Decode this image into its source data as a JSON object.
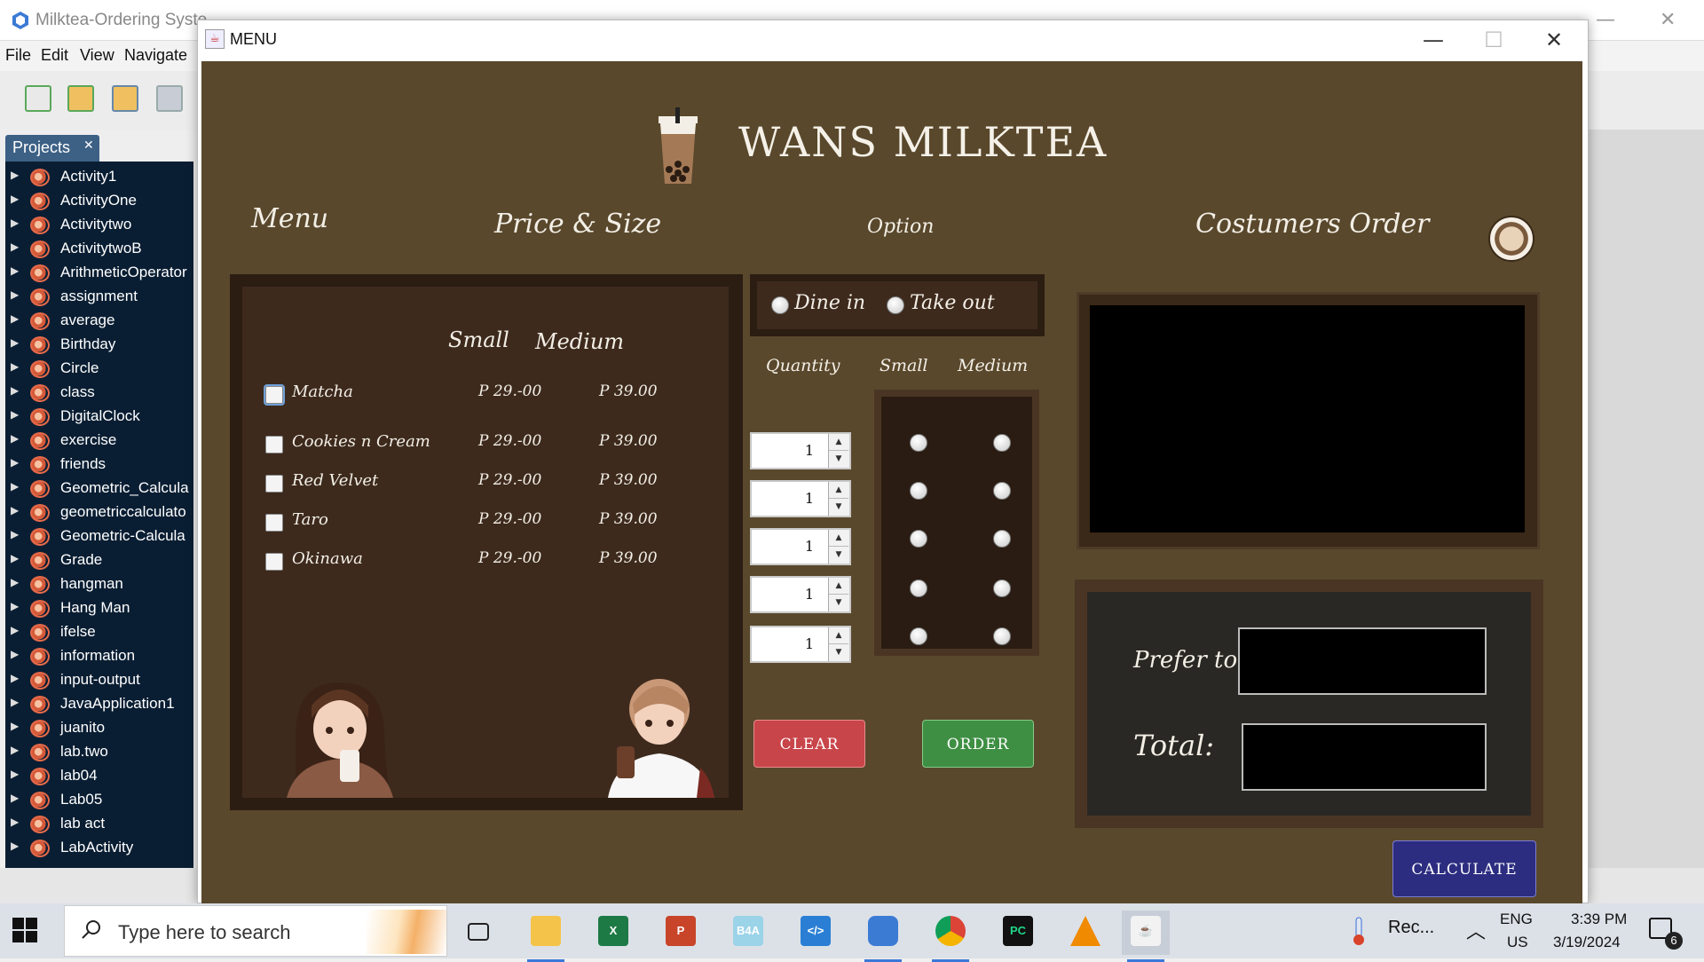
{
  "ide": {
    "title": "Milktea-Ordering Syste",
    "menus": [
      "File",
      "Edit",
      "View",
      "Navigate"
    ],
    "projects_tab": "Projects",
    "projects": [
      "Activity1",
      "ActivityOne",
      "Activitytwo",
      "ActivitytwoB",
      "ArithmeticOperator",
      "assignment",
      "average",
      "Birthday",
      "Circle",
      "class",
      "DigitalClock",
      "exercise",
      "friends",
      "Geometric_Calcula",
      "geometriccalculato",
      "Geometric-Calcula",
      "Grade",
      "hangman",
      "Hang Man",
      "ifelse",
      "information",
      "input-output",
      "JavaApplication1",
      "juanito",
      "lab.two",
      "lab04",
      "Lab05",
      "lab act",
      "LabActivity"
    ]
  },
  "window": {
    "title": "MENU",
    "minimize": "—",
    "maximize": "☐",
    "close": "✕"
  },
  "app": {
    "shop_name": "WANS MILKTEA",
    "headers": {
      "menu": "Menu",
      "price_size": "Price & Size",
      "option": "Option",
      "orders": "Costumers Order"
    },
    "price_cols": {
      "small": "Small",
      "medium": "Medium"
    },
    "items": [
      {
        "name": "Matcha",
        "small": "P 29.-00",
        "medium": "P 39.00",
        "checked": false
      },
      {
        "name": "Cookies n Cream",
        "small": "P 29.-00",
        "medium": "P 39.00",
        "checked": false
      },
      {
        "name": "Red Velvet",
        "small": "P 29.-00",
        "medium": "P 39.00",
        "checked": false
      },
      {
        "name": "Taro",
        "small": "P 29.-00",
        "medium": "P 39.00",
        "checked": false
      },
      {
        "name": "Okinawa",
        "small": "P 29.-00",
        "medium": "P 39.00",
        "checked": false
      }
    ],
    "options": {
      "dine_in": "Dine in",
      "take_out": "Take out"
    },
    "qty_cols": {
      "quantity": "Quantity",
      "small": "Small",
      "medium": "Medium"
    },
    "quantities": [
      "1",
      "1",
      "1",
      "1",
      "1"
    ],
    "buttons": {
      "clear": "CLEAR",
      "order": "ORDER",
      "calculate": "CALCULATE"
    },
    "prefer_label": "Prefer to:",
    "total_label": "Total:"
  },
  "taskbar": {
    "search_placeholder": "Type here to search",
    "rec": "Rec...",
    "lang1": "ENG",
    "lang2": "US",
    "time": "3:39 PM",
    "date": "3/19/2024",
    "notif_count": "6",
    "b4a": "B4A",
    "pc": "PC"
  }
}
